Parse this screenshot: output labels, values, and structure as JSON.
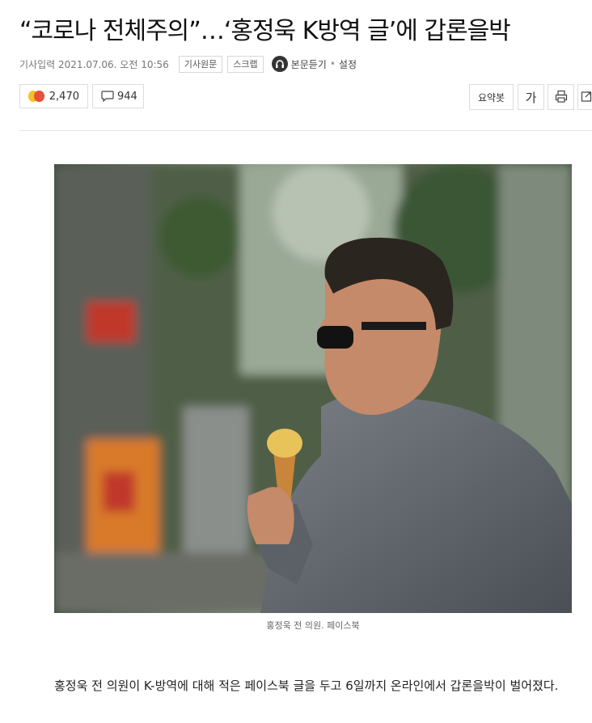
{
  "article": {
    "headline": "“코로나 전체주의”…‘홍정욱 K방역 글’에 갑론을박",
    "date": "기사입력 2021.07.06. 오전 10:56",
    "original_label": "기사원문",
    "scrap_label": "스크랩",
    "listen_label": "본문듣기",
    "settings_label": "설정",
    "separator": "•",
    "reactions_count": "2,470",
    "comments_count": "944",
    "caption": "홍정욱 전 의원. 페이스북",
    "body": "홍정욱 전 의원이 K-방역에 대해 적은 페이스북 글을 두고 6일까지 온라인에서 갑론을박이 벌어졌다."
  },
  "toolbar": {
    "summary_label": "요약봇",
    "font_label": "가"
  },
  "icons": {
    "reactions": [
      "laugh-emoji-icon",
      "angry-emoji-icon"
    ],
    "comment": "speech-bubble-icon",
    "listen": "listen-audio-icon",
    "print": "print-icon",
    "share": "share-icon"
  },
  "colors": {
    "emoji_yellow": "#f5c022",
    "emoji_red": "#e8503a"
  }
}
